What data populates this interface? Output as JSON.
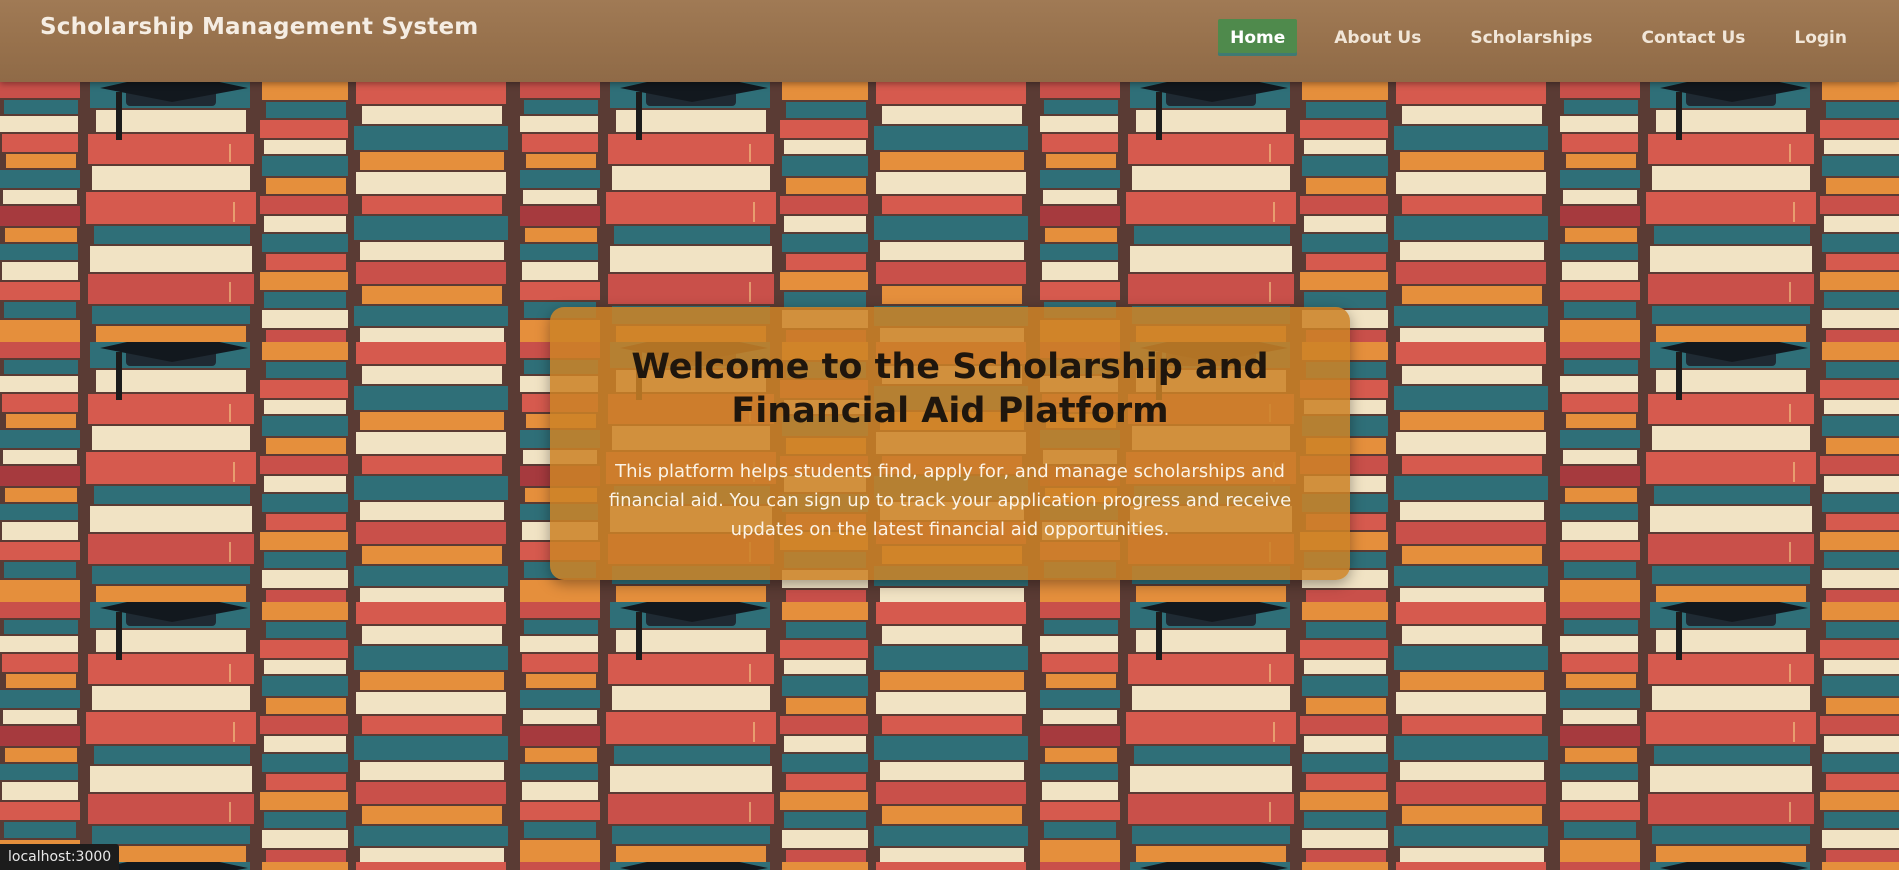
{
  "app": {
    "brand_title": "Scholarship Management System"
  },
  "nav": {
    "items": [
      {
        "label": "Home",
        "active": true
      },
      {
        "label": "About Us",
        "active": false
      },
      {
        "label": "Scholarships",
        "active": false
      },
      {
        "label": "Contact Us",
        "active": false
      },
      {
        "label": "Login",
        "active": false
      }
    ]
  },
  "hero": {
    "background_icon": "book-stacks-graduation-cap-pattern",
    "heading": "Welcome to the Scholarship and Financial Aid Platform",
    "description": "This platform helps students find, apply for, and manage scholarships and financial aid. You can sign up to track your application progress and receive updates on the latest financial aid opportunities."
  },
  "statusbar": {
    "url": "localhost:3000"
  },
  "colors": {
    "header_bg": "#9a744f",
    "active_nav_bg": "#4f8a4c",
    "card_bg": "#cc8226",
    "book_red": "#d65a4e",
    "book_teal": "#2f6f78",
    "book_cream": "#f1e3c4",
    "book_orange": "#e58f3c"
  }
}
